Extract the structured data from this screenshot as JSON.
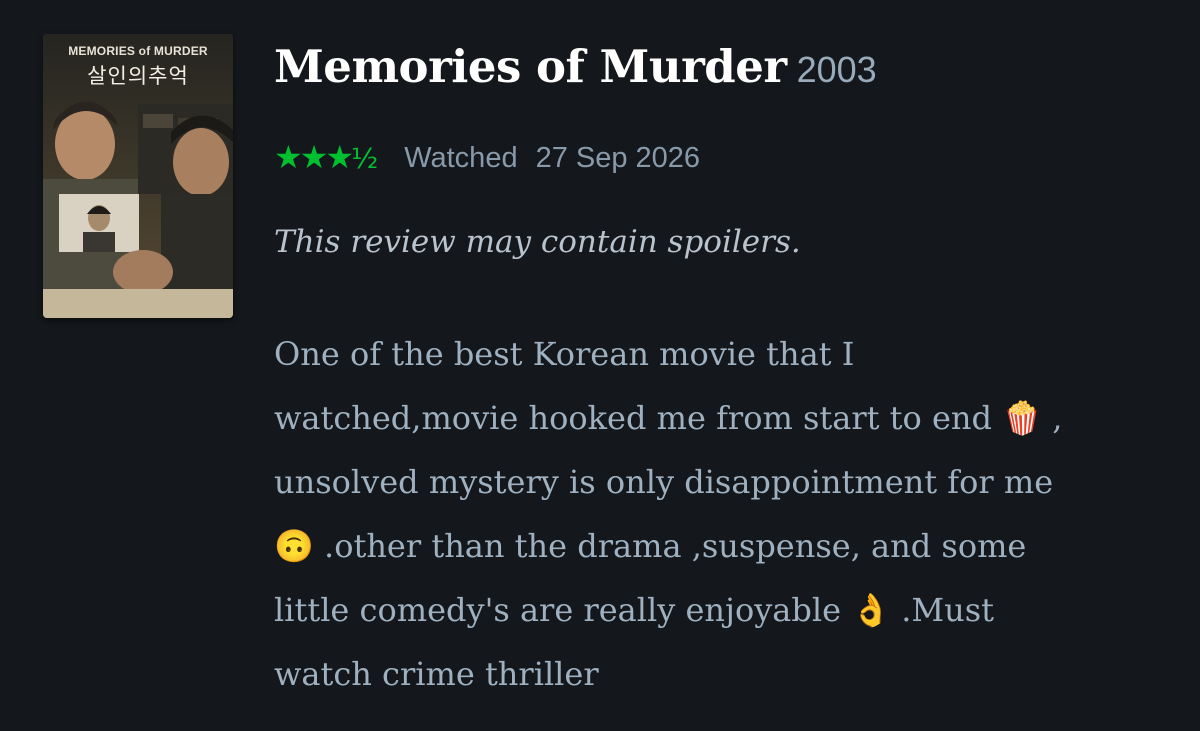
{
  "film": {
    "title": "Memories of Murder",
    "year": "2003",
    "poster": {
      "title_text": "MEMORIES of MURDER",
      "korean_title": "살인의추억"
    }
  },
  "review": {
    "rating": "★★★",
    "rating_half": "½",
    "rating_stars": 3.5,
    "watched_label": "Watched",
    "watched_date": "27 Sep 2026",
    "spoiler_notice": "This review may contain spoilers.",
    "body_lines": [
      "One of the best Korean movie that I",
      "watched,movie hooked me from start to end 🍿 ,",
      "unsolved mystery is only disappointment for me",
      "🙃 .other than the drama ,suspense, and some",
      "little comedy's are really enjoyable 👌 .Must",
      "watch crime thriller"
    ]
  },
  "colors": {
    "background": "#14181c",
    "title": "#ffffff",
    "rating_green": "#00c030",
    "muted_text": "#8899aa"
  }
}
